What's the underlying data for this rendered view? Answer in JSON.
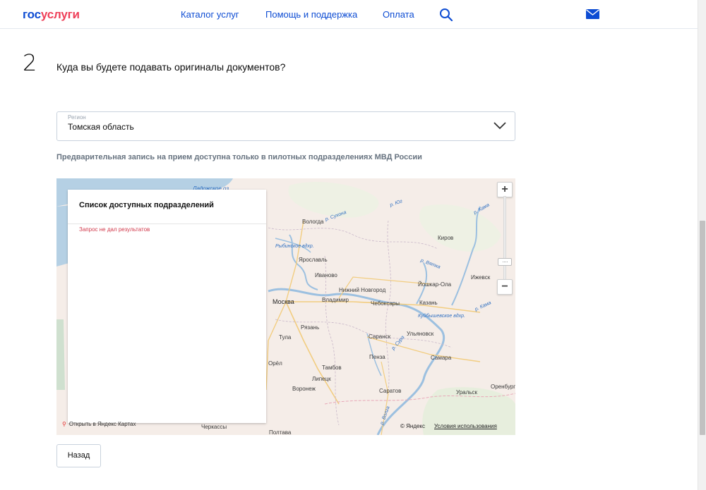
{
  "header": {
    "logo_part1": "гос",
    "logo_part2": "услуги",
    "nav": [
      "Каталог услуг",
      "Помощь и поддержка",
      "Оплата"
    ]
  },
  "step": {
    "number": "2",
    "title": "Куда вы будете подавать оригиналы документов?"
  },
  "region": {
    "label": "Регион",
    "value": "Томская область"
  },
  "notice": "Предварительная запись на прием доступна только в пилотных подразделениях МВД России",
  "map": {
    "list_title": "Список доступных подразделений",
    "list_empty": "Запрос не дал результатов",
    "zoom_in": "+",
    "zoom_out": "−",
    "open_in_yandex": "Открыть в Яндекс Картах",
    "copyright": "© Яндекс",
    "terms": "Условия использования",
    "cities": [
      "Ладожское оз.",
      "Вологда",
      "Киров",
      "Ярославль",
      "Иваново",
      "Ижевск",
      "Нижний Новгород",
      "Йошкар-Ола",
      "Москва",
      "Владимир",
      "Чебоксары",
      "Казань",
      "Рязань",
      "Саранск",
      "Ульяновск",
      "Тула",
      "Пенза",
      "Самара",
      "Орёл",
      "Тамбов",
      "Липецк",
      "Воронеж",
      "Саратов",
      "Уральск",
      "Оренбург",
      "Черкассы",
      "Полтава"
    ],
    "rivers": [
      "р. Сухона",
      "р. Юг",
      "р. Кама",
      "Рыбинское вдхр.",
      "р. Вятка",
      "Куйбышевское вдхр.",
      "р. Кама",
      "р. Сура",
      "р. Волга"
    ]
  },
  "back_button": "Назад",
  "colors": {
    "brand_blue": "#0d4cd3",
    "brand_red": "#ee3f58",
    "error_red": "#d1394b"
  }
}
